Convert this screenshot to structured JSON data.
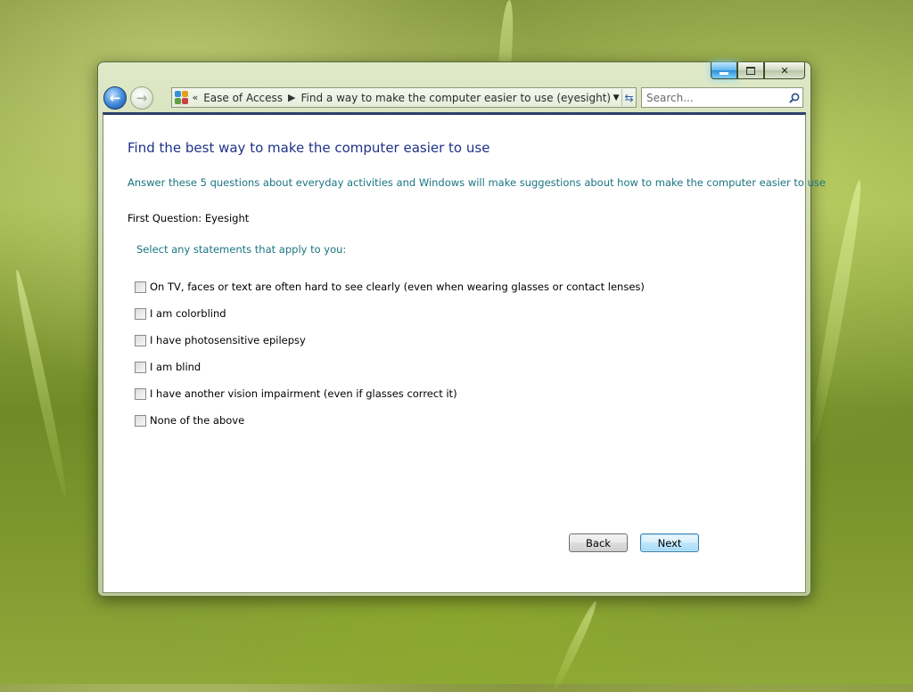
{
  "window": {
    "breadcrumb": [
      "Ease of Access",
      "Find a way to make the computer easier to use (eyesight)"
    ],
    "breadcrumb_prefix": "«",
    "search": {
      "placeholder": "Search..."
    }
  },
  "page": {
    "title": "Find the best way to make the computer easier to use",
    "subtitle": "Answer these 5 questions about everyday activities and Windows will make suggestions about how to make the computer easier to use",
    "question": "First Question: Eyesight",
    "instruction": "Select any statements that apply to you:",
    "options": [
      {
        "label": "On TV, faces or text are often hard to see clearly (even when wearing glasses or contact lenses)",
        "checked": false
      },
      {
        "label": "I am colorblind",
        "checked": false
      },
      {
        "label": "I have photosensitive epilepsy",
        "checked": false
      },
      {
        "label": "I am blind",
        "checked": false
      },
      {
        "label": "I have another vision impairment (even if glasses correct it)",
        "checked": false
      },
      {
        "label": "None of the above",
        "checked": false
      }
    ],
    "buttons": {
      "back": "Back",
      "next": "Next"
    }
  },
  "icons": {
    "back": "back-arrow-icon",
    "forward": "forward-arrow-icon",
    "control_panel": "control-panel-icon",
    "dropdown": "chevron-down-icon",
    "refresh": "refresh-icon",
    "search": "search-icon",
    "minimize": "minimize-icon",
    "maximize": "maximize-icon",
    "close": "close-icon"
  },
  "colors": {
    "title": "#1e3287",
    "instruction_text": "#1a7582",
    "content_bg": "#ffffff"
  }
}
